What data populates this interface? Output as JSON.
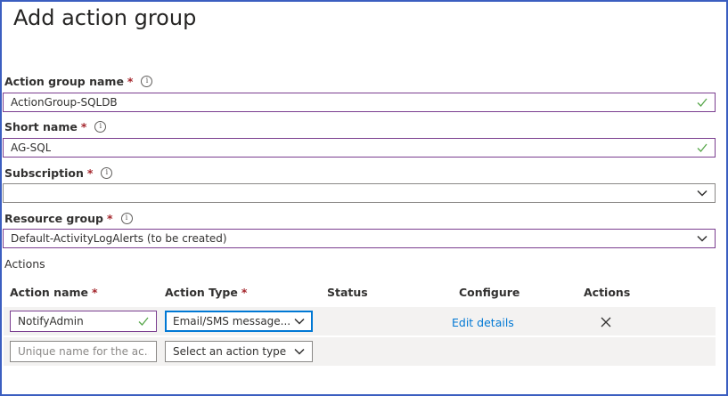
{
  "page": {
    "title": "Add action group"
  },
  "form": {
    "action_group_name": {
      "label": "Action group name",
      "required": "*",
      "value": "ActionGroup-SQLDB"
    },
    "short_name": {
      "label": "Short name",
      "required": "*",
      "value": "AG-SQL"
    },
    "subscription": {
      "label": "Subscription",
      "required": "*",
      "value": ""
    },
    "resource_group": {
      "label": "Resource group",
      "required": "*",
      "value": "Default-ActivityLogAlerts (to be created)"
    }
  },
  "actions": {
    "section_label": "Actions",
    "columns": {
      "action_name": "Action name",
      "action_name_required": "*",
      "action_type": "Action Type",
      "action_type_required": "*",
      "status": "Status",
      "configure": "Configure",
      "actions": "Actions"
    },
    "rows": [
      {
        "action_name": "NotifyAdmin",
        "action_type": "Email/SMS message...",
        "configure_link": "Edit details",
        "status": ""
      }
    ],
    "new_row": {
      "name_placeholder": "Unique name for the ac...",
      "type_placeholder": "Select an action type"
    }
  },
  "icons": {
    "info": "info-icon",
    "valid": "checkmark-icon",
    "dropdown": "chevron-down-icon",
    "delete": "close-icon"
  },
  "colors": {
    "frame_border": "#3b5ec0",
    "field_border_active": "#7a3d8f",
    "checkmark": "#57a64a",
    "required": "#a4262c",
    "link": "#0078d4",
    "row_band": "#f3f2f1"
  }
}
